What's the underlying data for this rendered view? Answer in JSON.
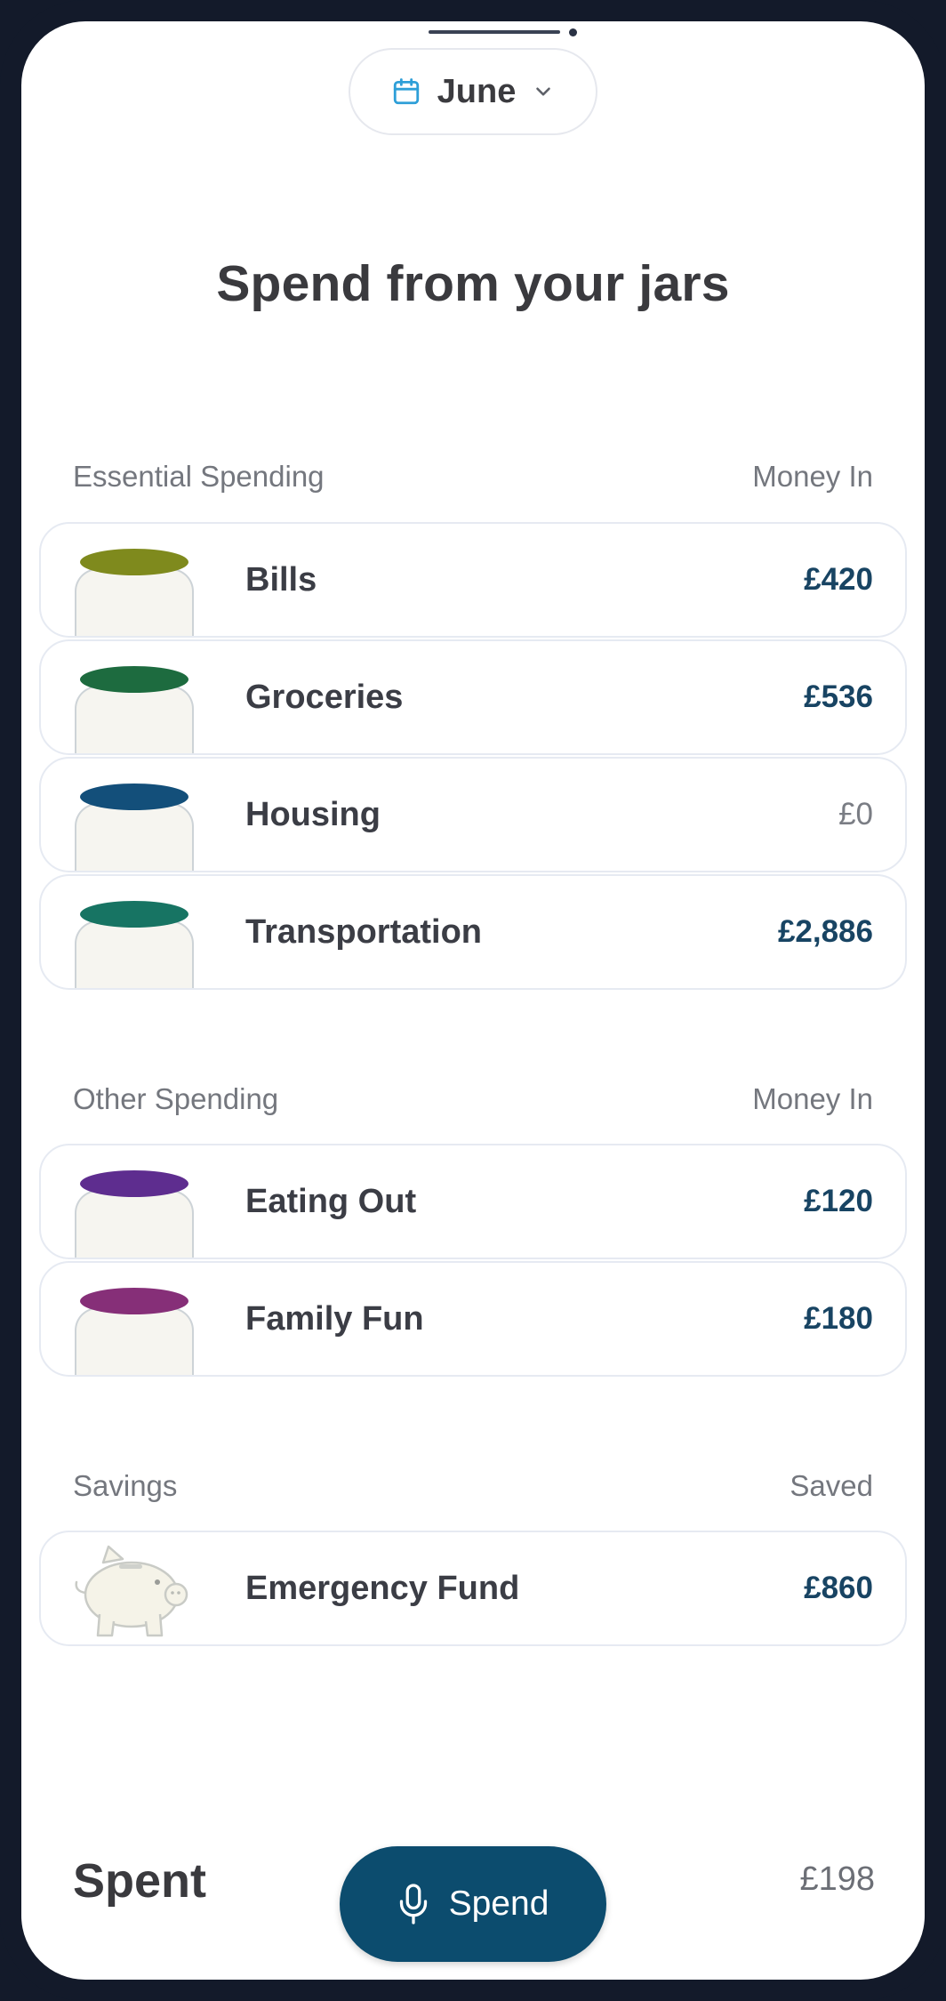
{
  "header": {
    "month": "June",
    "month_icon": "calendar-icon",
    "dropdown_icon": "chevron-down-icon"
  },
  "page": {
    "title": "Spend from your jars"
  },
  "essential": {
    "heading": "Essential Spending",
    "column": "Money In",
    "jars": [
      {
        "name": "Bills",
        "amount": "£420",
        "lid_color": "#7f8a1d"
      },
      {
        "name": "Groceries",
        "amount": "£536",
        "lid_color": "#1d6b3f"
      },
      {
        "name": "Housing",
        "amount": "£0",
        "lid_color": "#134f7a"
      },
      {
        "name": "Transportation",
        "amount": "£2,886",
        "lid_color": "#177463"
      }
    ]
  },
  "other": {
    "heading": "Other Spending",
    "column": "Money In",
    "jars": [
      {
        "name": "Eating Out",
        "amount": "£120",
        "lid_color": "#5e2d8f"
      },
      {
        "name": "Family Fun",
        "amount": "£180",
        "lid_color": "#862f78"
      }
    ]
  },
  "savings": {
    "heading": "Savings",
    "column": "Saved",
    "items": [
      {
        "name": "Emergency Fund",
        "amount": "£860",
        "icon": "piggy-bank-icon"
      }
    ]
  },
  "footer": {
    "spent_label": "Spent",
    "spent_value": "£198",
    "spend_button_label": "Spend",
    "spend_icon": "microphone-icon"
  },
  "colors": {
    "frame": "#131a2a",
    "primary": "#0c4c6e",
    "amount_text": "#184463"
  }
}
